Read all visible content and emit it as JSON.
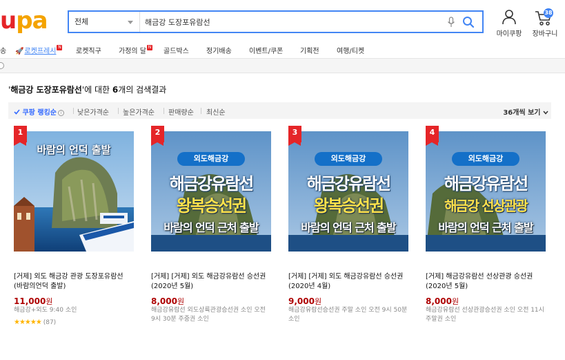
{
  "header": {
    "logo_text": "upang",
    "search": {
      "category": "전체",
      "query": "해금강 도장포유람선"
    },
    "mycoupang_label": "마이쿠팡",
    "cart_label": "장바구니",
    "cart_count": "38"
  },
  "gnb": {
    "items": [
      {
        "label": "송"
      },
      {
        "label": "로켓프레시",
        "rocket": true,
        "new": true
      },
      {
        "label": "로켓직구"
      },
      {
        "label": "가정의 달",
        "new": true
      },
      {
        "label": "골드박스"
      },
      {
        "label": "정기배송"
      },
      {
        "label": "이벤트/쿠폰"
      },
      {
        "label": "기획전"
      },
      {
        "label": "여행/티켓"
      }
    ],
    "new_badge": "N"
  },
  "results": {
    "prefix": "'",
    "keyword": "해금강 도장포유람선",
    "middle": "'에 대한 ",
    "count": "6",
    "suffix": "개의 검색결과"
  },
  "sort": {
    "items": [
      "쿠팡 랭킹순",
      "낮은가격순",
      "높은가격순",
      "판매량순",
      "최신순"
    ],
    "info": "i",
    "perpage": "36개씩 보기"
  },
  "products": [
    {
      "rank": "1",
      "image_text": [
        "바람의 언덕 출발"
      ],
      "name": "[거제] 외도 해금강 관광 도장포유람선 (바람의언덕 출발)",
      "price": "11,000",
      "currency": "원",
      "sub": "해금강+외도 9:40 소인",
      "rating": 4.5,
      "stars": "★★★★★",
      "reviews": "(87)"
    },
    {
      "rank": "2",
      "image_text": [
        "외도해금강",
        "해금강유람선",
        "왕복승선권",
        "바람의 언덕 근처 출발"
      ],
      "name": "[거제] [거제] 외도 해금강유람선 승선권(2020년 5월)",
      "price": "8,000",
      "currency": "원",
      "sub": "해금강유람선 외도상륙관광승선권 소인 오전 9시 30분 주중권 소인"
    },
    {
      "rank": "3",
      "image_text": [
        "외도해금강",
        "해금강유람선",
        "왕복승선권",
        "바람의 언덕 근처 출발"
      ],
      "name": "[거제] [거제] 외도 해금강유람선 승선권(2020년 4월)",
      "price": "9,000",
      "currency": "원",
      "sub": "해금강유람선승선권 주말 소인 오전 9시 50분 소인"
    },
    {
      "rank": "4",
      "image_text": [
        "외도해금강",
        "해금강유람선",
        "해금강 선상관광",
        "바람의 언덕 근처 출발"
      ],
      "name": "[거제] 해금강유람선 선상관광 승선권(2020년 5월)",
      "price": "8,000",
      "currency": "원",
      "sub": "해금강유람선 선상관광승선권 소인 오전 11시 주말권 소인"
    }
  ],
  "colors": {
    "accent": "#4285f4",
    "price": "#ae0000",
    "rank_badge": "#e52528",
    "sort_active": "#346aff"
  }
}
